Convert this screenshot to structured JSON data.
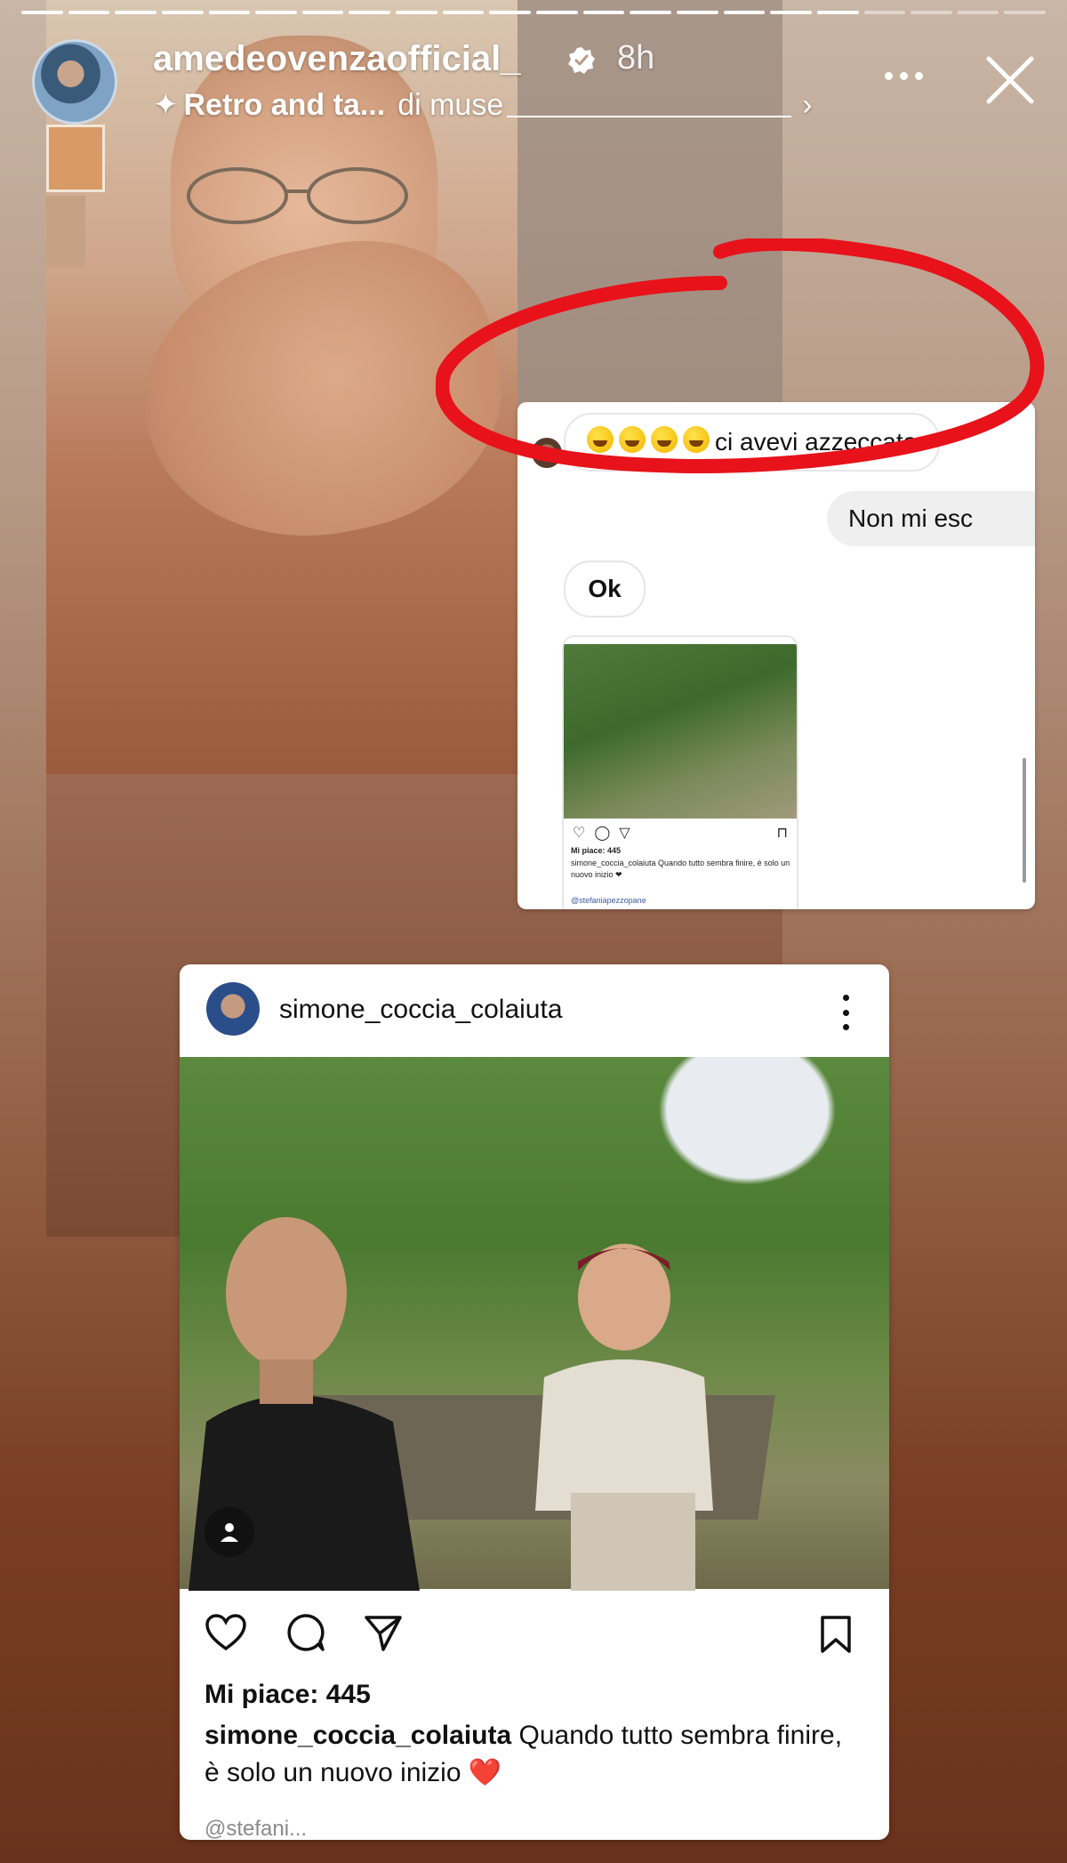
{
  "story": {
    "segment_count": 22,
    "segments_done": 18,
    "username": "amedeovenzaofficial_",
    "timestamp": "8h",
    "music_title": "Retro and ta...",
    "music_artist": "di muse"
  },
  "dm_screenshot": {
    "received_message": "ci avevi azzeccato",
    "emoji_count": 4,
    "sent_message": "Non mi esc",
    "reply_message": "Ok",
    "mini_post_likes": "Mi piace: 445",
    "mini_post_caption": "simone_coccia_colaiuta Quando tutto sembra finire, è solo un nuovo inizio ❤",
    "mini_post_tag": "@stefaniapezzopane"
  },
  "shared_post": {
    "username": "simone_coccia_colaiuta",
    "likes": "Mi piace: 445",
    "caption_user": "simone_coccia_colaiuta",
    "caption_text": " Quando tutto sembra finire, è solo un nuovo inizio ",
    "caption_emoji": "❤️",
    "truncated_text": "@stefani..."
  },
  "colors": {
    "accent_red": "#e8121b",
    "verified_blue": "#ffffff"
  }
}
